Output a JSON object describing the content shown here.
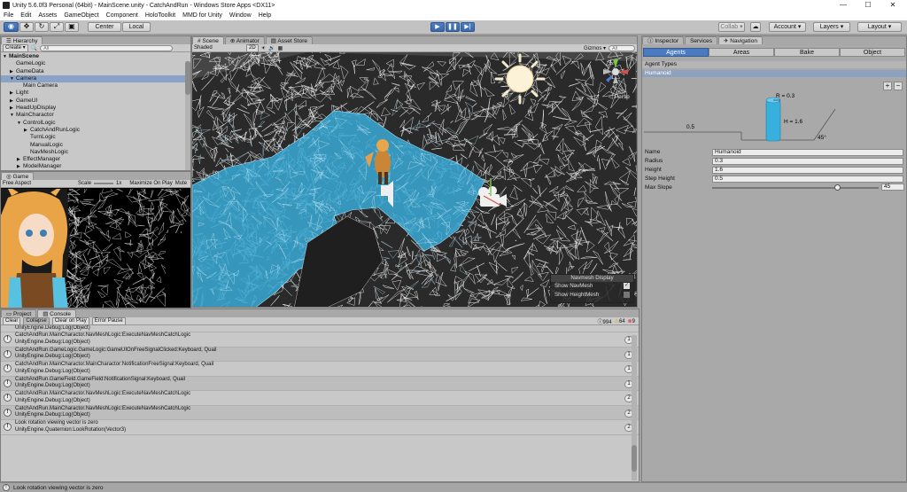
{
  "window": {
    "title": "Unity 5.6.0f3 Personal (64bit) - MainScene.unity - CatchAndRun - Windows Store Apps <DX11>",
    "minimize": "—",
    "maximize": "☐",
    "close": "✕"
  },
  "menu": [
    "File",
    "Edit",
    "Assets",
    "GameObject",
    "Component",
    "HoloToolkit",
    "MMD for Unity",
    "Window",
    "Help"
  ],
  "toolbar": {
    "center_label": "Center",
    "local_label": "Local",
    "collab_label": "Collab ▾",
    "account_label": "Account ▾",
    "layers_label": "Layers ▾",
    "layout_label": "Layout ▾",
    "accent_color": "#3a68a8"
  },
  "hierarchy": {
    "tab": "Hierarchy",
    "create_label": "Create ▾",
    "search_placeholder": "All",
    "items": [
      {
        "label": "MainScene",
        "indent": 0,
        "arrow": "▼",
        "bold": true
      },
      {
        "label": "GameLogic",
        "indent": 1,
        "arrow": ""
      },
      {
        "label": "GameData",
        "indent": 1,
        "arrow": "▶"
      },
      {
        "label": "Camera",
        "indent": 1,
        "arrow": "▼",
        "selected": true
      },
      {
        "label": "Main Camera",
        "indent": 2,
        "arrow": ""
      },
      {
        "label": "Light",
        "indent": 1,
        "arrow": "▶"
      },
      {
        "label": "GameUI",
        "indent": 1,
        "arrow": "▶"
      },
      {
        "label": "HeadUpDisplay",
        "indent": 1,
        "arrow": "▶"
      },
      {
        "label": "MainCharactor",
        "indent": 1,
        "arrow": "▼"
      },
      {
        "label": "ControlLogic",
        "indent": 2,
        "arrow": "▼"
      },
      {
        "label": "CatchAndRunLogic",
        "indent": 3,
        "arrow": "▶"
      },
      {
        "label": "TurnLogic",
        "indent": 3,
        "arrow": ""
      },
      {
        "label": "ManualLogic",
        "indent": 3,
        "arrow": ""
      },
      {
        "label": "NavMeshLogic",
        "indent": 3,
        "arrow": ""
      },
      {
        "label": "EffectManager",
        "indent": 2,
        "arrow": "▶"
      },
      {
        "label": "ModelManager",
        "indent": 2,
        "arrow": "▶"
      }
    ]
  },
  "game": {
    "tab": "Game",
    "aspect": "Free Aspect",
    "scale_label": "Scale",
    "scale_value": "1x",
    "maximize_label": "Maximize On Play",
    "mute_label": "Mute"
  },
  "scene": {
    "tabs": [
      "Scene",
      "Animator",
      "Asset Store"
    ],
    "shaded": "Shaded",
    "mode_2d": "2D",
    "gizmos_label": "Gizmos ▾",
    "search_placeholder": "All",
    "persp_label": "◁ Persp",
    "navmesh_color": "#3aa9d6",
    "navmesh_display": {
      "title": "Navmesh Display",
      "show_navmesh": "Show NavMesh",
      "show_heightmesh": "Show HeightMesh",
      "show_navmesh_checked": true,
      "show_heightmesh_checked": false
    }
  },
  "inspector": {
    "tabs": [
      "Inspector",
      "Services",
      "Navigation"
    ],
    "nav_tabs": [
      "Agents",
      "Areas",
      "Bake",
      "Object"
    ],
    "active_nav_tab": "Agents",
    "agent_types_label": "Agent Types",
    "agent_selected": "Humanoid",
    "plus": "+",
    "minus": "−",
    "diagram": {
      "r_label": "R = 0.3",
      "h_label": "H = 1.6",
      "step_label": "0.5",
      "slope_label": "45°"
    },
    "fields": [
      {
        "label": "Name",
        "value": "Humanoid"
      },
      {
        "label": "Radius",
        "value": "0.3"
      },
      {
        "label": "Height",
        "value": "1.6"
      },
      {
        "label": "Step Height",
        "value": "0.5"
      },
      {
        "label": "Max Slope",
        "value": "45"
      }
    ],
    "max_slope_fraction": 0.75
  },
  "console": {
    "tabs": [
      "Project",
      "Console"
    ],
    "buttons": [
      "Clear",
      "Collapse",
      "Clear on Play",
      "Error Pause"
    ],
    "counts": {
      "info": "994",
      "warn": "64",
      "error": "9"
    },
    "partial_top": "UnityEngine.Debug:Log(Object)",
    "rows": [
      {
        "line1": "CatchAndRun.MainCharactor.NavMeshLogic:ExecuteNavMeshCatchLogic",
        "line2": "UnityEngine.Debug:Log(Object)",
        "count": "1"
      },
      {
        "line1": "CatchAndRun.GameLogic.GameLogic:GameUIOnFreeSignalClicked:Keyboard, Quail",
        "line2": "UnityEngine.Debug:Log(Object)",
        "count": "1"
      },
      {
        "line1": "CatchAndRun.MainCharactor.MainCharactor:NotificationFreeSignal:Keyboard, Quail",
        "line2": "UnityEngine.Debug:Log(Object)",
        "count": "1"
      },
      {
        "line1": "CatchAndRun.GameField.GameField:NotificationSignal:Keyboard, Quail",
        "line2": "UnityEngine.Debug:Log(Object)",
        "count": "1"
      },
      {
        "line1": "CatchAndRun.MainCharactor.NavMeshLogic:ExecuteNavMeshCatchLogic",
        "line2": "UnityEngine.Debug:Log(Object)",
        "count": "2"
      },
      {
        "line1": "CatchAndRun.MainCharactor.NavMeshLogic:ExecuteNavMeshCatchLogic",
        "line2": "UnityEngine.Debug:Log(Object)",
        "count": "2"
      },
      {
        "line1": "Look rotation viewing vector is zero",
        "line2": "UnityEngine.Quaternion:LookRotation(Vector3)",
        "count": "2"
      }
    ]
  },
  "status": {
    "message": "Look rotation viewing vector is zero"
  }
}
